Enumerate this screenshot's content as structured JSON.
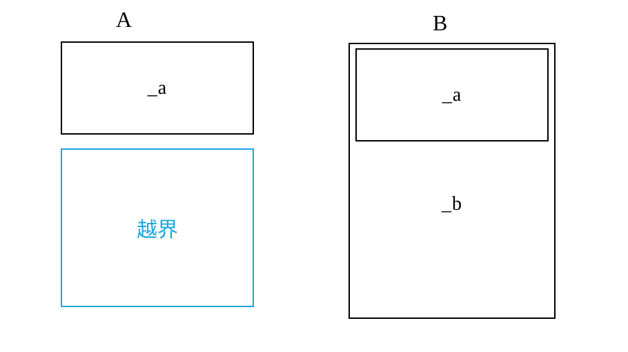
{
  "labels": {
    "leftTitle": "A",
    "rightTitle": "B"
  },
  "left": {
    "boxA": "_a",
    "overflow": "越界"
  },
  "right": {
    "innerA": "_a",
    "innerB": "_b"
  },
  "colors": {
    "blue": "#1ca6e0",
    "black": "#000000"
  }
}
